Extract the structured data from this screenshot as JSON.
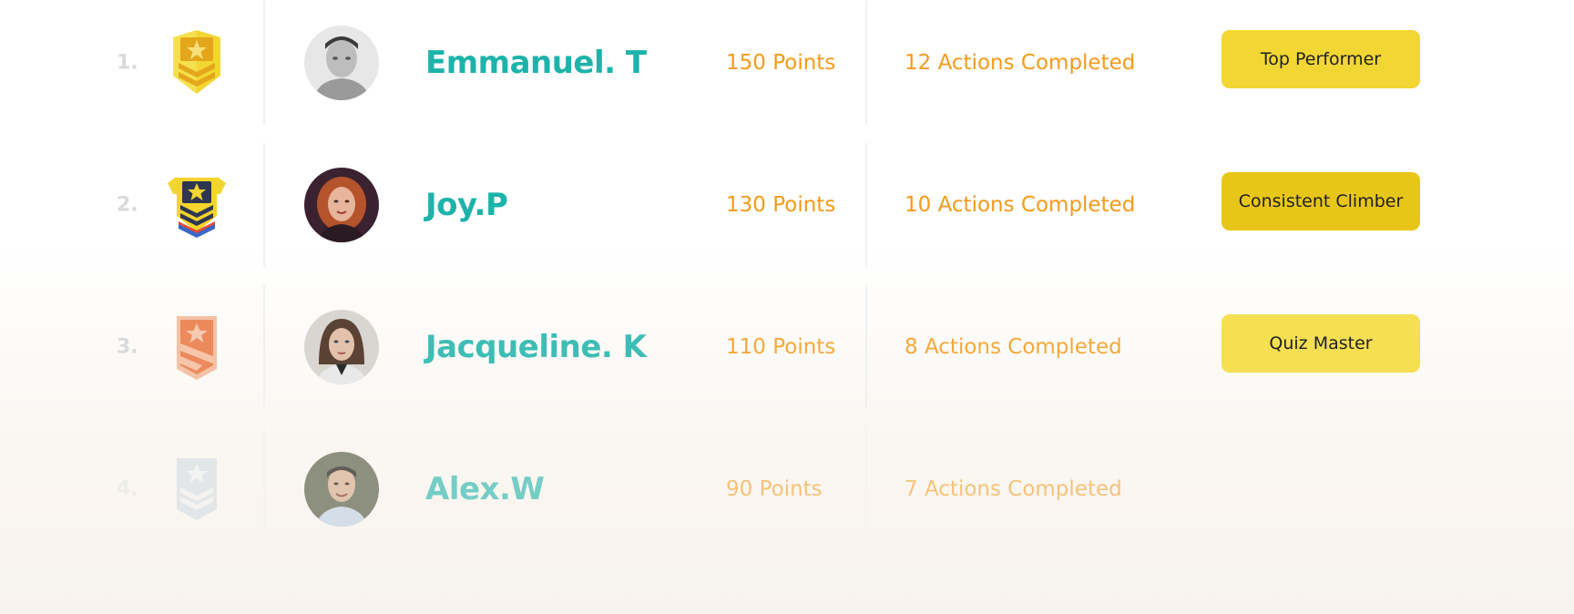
{
  "leaderboard": {
    "rows": [
      {
        "rank": "1.",
        "badge_icon": "gold-star-chevron-badge-icon",
        "name": "Emmanuel. T",
        "points": "150 Points",
        "actions": "12 Actions Completed",
        "tag": "Top Performer",
        "tag_color": "#f2d633"
      },
      {
        "rank": "2.",
        "badge_icon": "gold-navy-star-chevron-badge-icon",
        "name": "Joy.P",
        "points": "130 Points",
        "actions": "10 Actions Completed",
        "tag": "Consistent Climber",
        "tag_color": "#e8c619"
      },
      {
        "rank": "3.",
        "badge_icon": "bronze-star-shield-badge-icon",
        "name": "Jacqueline. K",
        "points": "110 Points",
        "actions": "8 Actions Completed",
        "tag": "Quiz Master",
        "tag_color": "#f5df52"
      },
      {
        "rank": "4.",
        "badge_icon": "silver-star-chevron-badge-icon",
        "name": "Alex.W",
        "points": "90 Points",
        "actions": "7 Actions Completed"
      }
    ]
  },
  "colors": {
    "name": "#1db3aa",
    "stats": "#f49a1a",
    "rank": "#d9d9d9"
  }
}
